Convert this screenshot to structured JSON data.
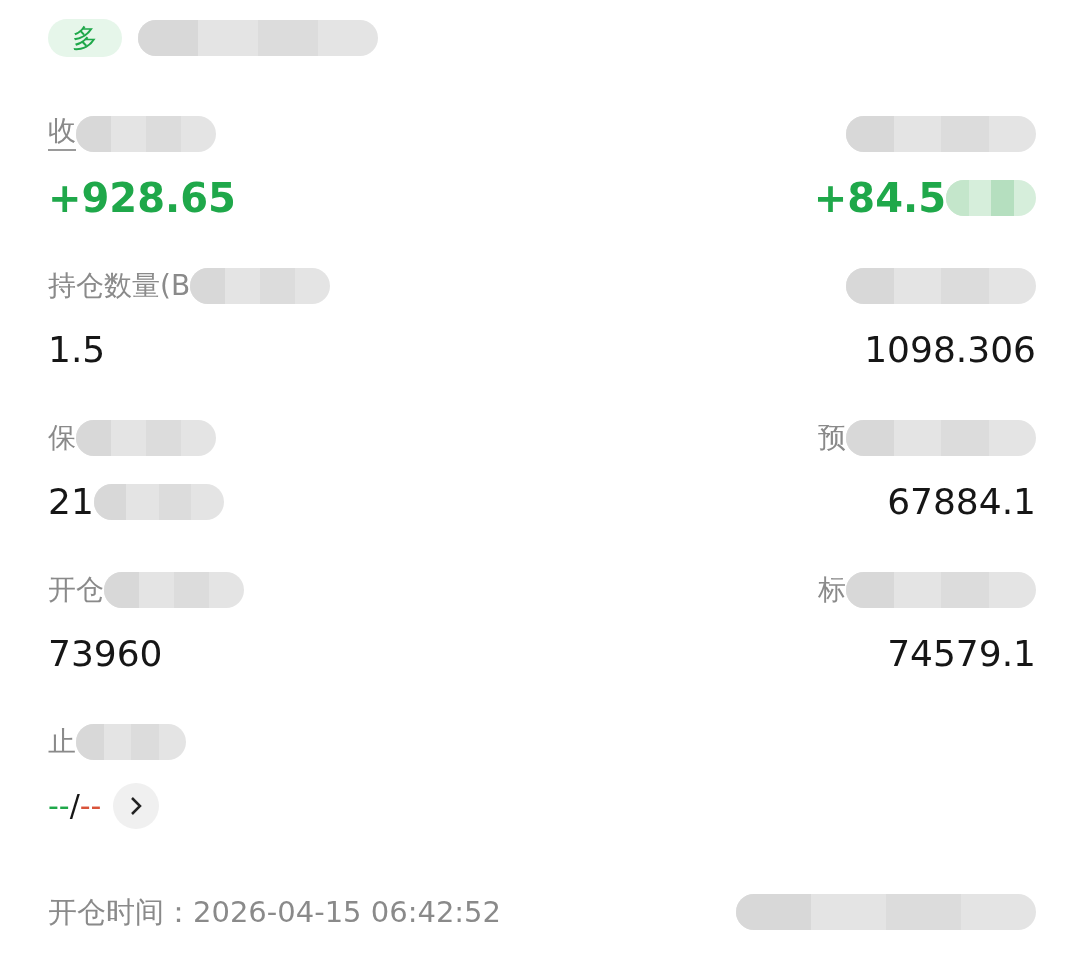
{
  "side_badge": {
    "label": "多",
    "redacted": true
  },
  "rows": [
    {
      "left": {
        "label": "收",
        "label_redacted": true,
        "dashed": true,
        "value": "+928.65",
        "kind": "pnl"
      },
      "right": {
        "label_redacted": true,
        "value": "+84.5",
        "kind": "pnl",
        "value_redacted": true
      }
    },
    {
      "left": {
        "label": "持仓数量(B",
        "label_redacted": true,
        "value": "1.5",
        "kind": "plain"
      },
      "right": {
        "label_redacted": true,
        "value": "1098.306",
        "kind": "plain"
      }
    },
    {
      "left": {
        "label": "保",
        "label_redacted": true,
        "value": "21",
        "kind": "plain",
        "value_redacted": true
      },
      "right": {
        "label": "预",
        "label_redacted": true,
        "value": "67884.1",
        "kind": "plain"
      }
    },
    {
      "left": {
        "label": "开仓",
        "label_redacted": true,
        "value": "73960",
        "kind": "plain"
      },
      "right": {
        "label": "标",
        "label_redacted": true,
        "value": "74579.1",
        "kind": "plain"
      }
    }
  ],
  "tp_sl": {
    "label": "止",
    "label_redacted": true,
    "take_profit": "--",
    "separator": "/",
    "stop_loss": "--"
  },
  "open_time": {
    "text": "开仓时间：2026-04-15 06:42:52",
    "right_redacted": true
  }
}
